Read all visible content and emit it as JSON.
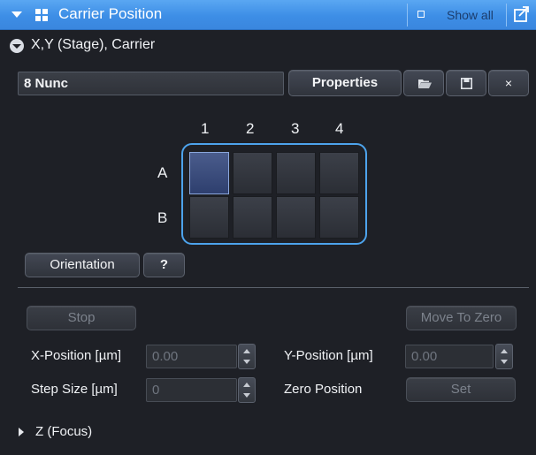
{
  "title_bar": {
    "title": "Carrier Position",
    "show_all_label": "Show all"
  },
  "stage_section": {
    "label": "X,Y (Stage), Carrier"
  },
  "carrier": {
    "name_value": "8 Nunc",
    "properties_label": "Properties",
    "close_label": "×",
    "columns": [
      "1",
      "2",
      "3",
      "4"
    ],
    "rows": [
      "A",
      "B"
    ],
    "selected_well": "A1"
  },
  "orientation_label": "Orientation",
  "help_label": "?",
  "stop_label": "Stop",
  "move_to_zero_label": "Move To Zero",
  "x_position": {
    "label": "X-Position [µm]",
    "value": "0.00"
  },
  "y_position": {
    "label": "Y-Position [µm]",
    "value": "0.00"
  },
  "step_size": {
    "label": "Step Size [µm]",
    "value": "0"
  },
  "zero_position": {
    "label": "Zero Position",
    "set_label": "Set"
  },
  "z_section": {
    "label": "Z (Focus)"
  },
  "colors": {
    "title_bar": "#3d8ee6",
    "background": "#1e2026",
    "frame": "#4da3ec",
    "selected_well": "#3a4c7e"
  }
}
